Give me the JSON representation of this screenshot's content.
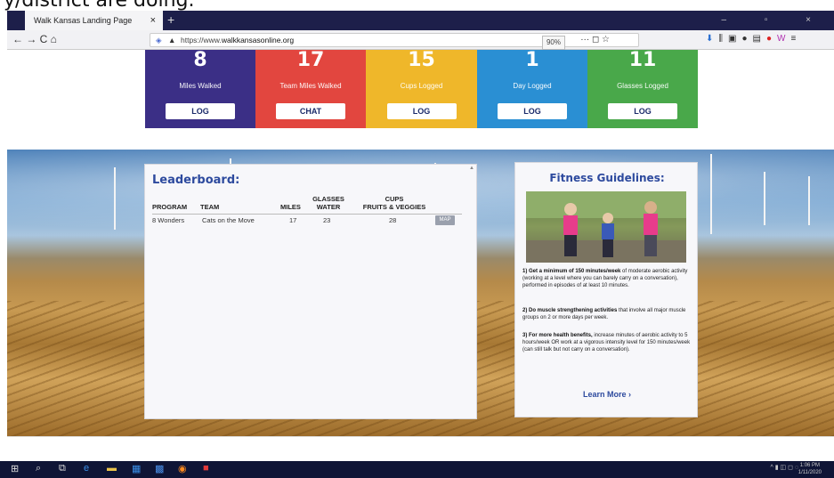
{
  "caption": "y/district are doing.",
  "browser": {
    "tab_title": "Walk Kansas Landing Page",
    "tab_close": "×",
    "new_tab": "+",
    "window_controls": "– ▫ ×",
    "url_prefix": "https://www.",
    "url_domain": "walkkansasonline.org",
    "zoom": "90%",
    "url_menu": "··· ◻ ☆",
    "nav_icons": "← → C ⌂"
  },
  "cards": [
    {
      "value": "8",
      "label": "Miles Walked",
      "button": "LOG",
      "color": "#3b2f86"
    },
    {
      "value": "17",
      "label": "Team Miles Walked",
      "button": "CHAT",
      "color": "#e2463f"
    },
    {
      "value": "15",
      "label": "Cups Logged",
      "button": "LOG",
      "color": "#efb72a"
    },
    {
      "value": "1",
      "label": "Day Logged",
      "button": "LOG",
      "color": "#2a8fd3"
    },
    {
      "value": "11",
      "label": "Glasses Logged",
      "button": "LOG",
      "color": "#49a84a"
    }
  ],
  "leaderboard": {
    "title": "Leaderboard:",
    "headers": {
      "program": "PROGRAM",
      "team": "TEAM",
      "miles": "MILES",
      "glasses_1": "GLASSES",
      "glasses_2": "WATER",
      "cups_1": "CUPS",
      "cups_2": "FRUITS & VEGGIES"
    },
    "row": {
      "program": "8 Wonders",
      "team": "Cats on the Move",
      "miles": "17",
      "water": "23",
      "cups": "28",
      "map": "MAP"
    }
  },
  "fitness": {
    "title": "Fitness Guidelines:",
    "g1_bold": "1) Get a minimum of 150 minutes/week",
    "g1_rest": " of moderate aerobic activity (working at a level where you can barely carry on a conversation), performed in episodes of at least 10 minutes.",
    "g2_bold": "2) Do muscle strengthening activities",
    "g2_rest": " that involve all major muscle groups on 2 or more days per week.",
    "g3_bold": "3) For more health benefits,",
    "g3_rest": " increase minutes of aerobic activity to 5 hours/week OR work at a vigorous intensity level for 150 minutes/week (can still talk but not carry on a conversation).",
    "learn_more": "Learn More ›"
  },
  "taskbar": {
    "time": "1:06 PM",
    "date": "1/11/2020"
  }
}
